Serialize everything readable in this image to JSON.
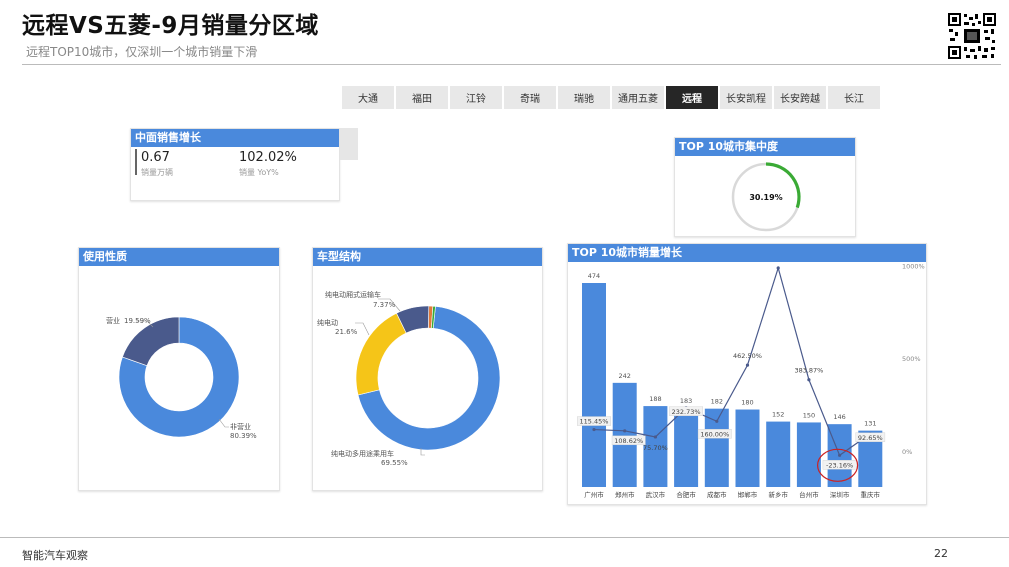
{
  "header": {
    "title": "远程VS五菱-9月销量分区域",
    "subtitle": "远程TOP10城市，仅深圳一个城市销量下滑"
  },
  "tabs": [
    {
      "label": "大通",
      "active": false
    },
    {
      "label": "福田",
      "active": false
    },
    {
      "label": "江铃",
      "active": false
    },
    {
      "label": "奇瑞",
      "active": false
    },
    {
      "label": "瑞驰",
      "active": false
    },
    {
      "label": "通用五菱",
      "active": false
    },
    {
      "label": "远程",
      "active": true
    },
    {
      "label": "长安凯程",
      "active": false
    },
    {
      "label": "长安跨越",
      "active": false
    },
    {
      "label": "长江",
      "active": false
    }
  ],
  "kpi": {
    "title": "中面销售增长",
    "value1": "0.67",
    "label1": "销量万辆",
    "value2": "102.02%",
    "label2": "销量 YoY%"
  },
  "concentration": {
    "title": "TOP 10城市集中度",
    "value_label": "30.19%"
  },
  "footer": {
    "left": "智能汽车观察",
    "page": "22"
  },
  "colors": {
    "accent": "#4a89dc",
    "dark_blue": "#4a5a8c",
    "yellow": "#f5c518",
    "green": "#3aaa35",
    "line": "#4a5a8c",
    "highlight_circle": "#cc2222",
    "active_tab": "#262626"
  },
  "chart_data": [
    {
      "type": "gauge",
      "title": "TOP 10城市集中度",
      "value": 30.19,
      "max": 100,
      "label": "30.19%"
    },
    {
      "type": "pie",
      "donut": true,
      "title": "使用性质",
      "slices": [
        {
          "name": "非营业",
          "value": 80.39,
          "label": "80.39%",
          "color": "#4a89dc"
        },
        {
          "name": "营业",
          "value": 19.59,
          "label": "19.59%",
          "color": "#4a5a8c"
        }
      ]
    },
    {
      "type": "pie",
      "donut": true,
      "title": "车型结构",
      "slices": [
        {
          "name": "纯电动多用途乘用车",
          "value": 69.55,
          "label": "69.55%",
          "color": "#4a89dc"
        },
        {
          "name": "纯电动",
          "value": 21.6,
          "label": "21.6%",
          "color": "#f5c518"
        },
        {
          "name": "纯电动厢式运输车",
          "value": 7.37,
          "label": "7.37%",
          "color": "#4a5a8c"
        },
        {
          "name": "",
          "value": 0.9,
          "label": "",
          "color": "#e07a3a"
        },
        {
          "name": "",
          "value": 0.58,
          "label": "",
          "color": "#3aaa35"
        }
      ]
    },
    {
      "type": "bar",
      "title": "TOP 10城市销量增长",
      "categories": [
        "广州市",
        "郑州市",
        "武汉市",
        "合肥市",
        "成都市",
        "邯郸市",
        "新乡市",
        "台州市",
        "深圳市",
        "重庆市"
      ],
      "series": [
        {
          "values": [
            474,
            242,
            188,
            183,
            182,
            180,
            152,
            150,
            146,
            131
          ],
          "value_labels": [
            "474",
            "242",
            "188",
            "183",
            "182",
            "180",
            "152",
            "150",
            "146",
            "131"
          ]
        },
        {
          "type": "line",
          "axis": "right",
          "values": [
            115.45,
            108.62,
            75.7,
            232.73,
            160.0,
            462.5,
            985.71,
            383.87,
            -23.16,
            92.65
          ],
          "value_labels": [
            "115.45%",
            "108.62%",
            "75.70%",
            "232.73%",
            "160.00%",
            "462.50%",
            "985.71%",
            "383.87%",
            "-23.16%",
            "92.65%"
          ]
        }
      ],
      "ylim": [
        0,
        500
      ],
      "y2lim": [
        -100,
        1000
      ],
      "y2_ticks": [
        "1000%",
        "500%",
        "0%"
      ],
      "highlight": "深圳市"
    }
  ]
}
